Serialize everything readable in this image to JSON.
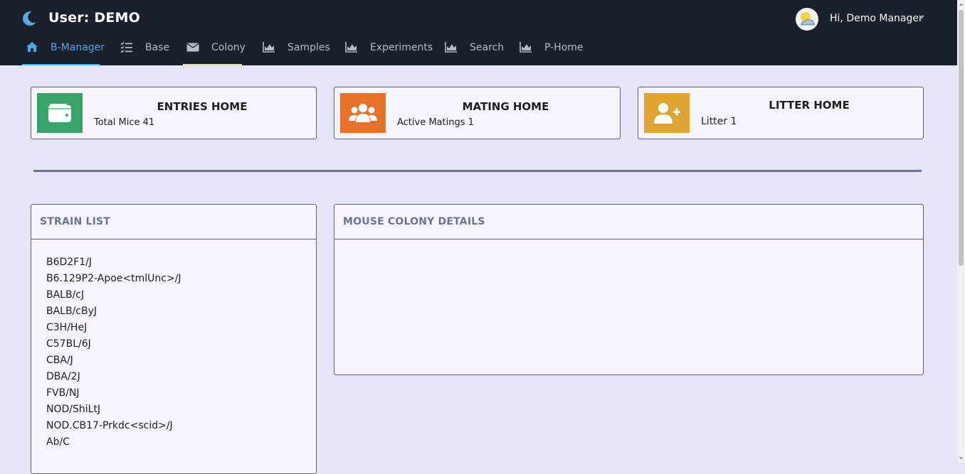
{
  "header": {
    "title": "User: DEMO",
    "greeting": "Hi, Demo Manager",
    "icons": {
      "brand": "moon-icon",
      "avatar": "weather-avatar-icon",
      "menu": "chevron-down-icon"
    }
  },
  "nav": {
    "items": [
      {
        "label": "B-Manager",
        "icon": "home-icon",
        "active": true
      },
      {
        "label": "Base",
        "icon": "checklist-icon",
        "active": false
      },
      {
        "label": "Colony",
        "icon": "envelope-icon",
        "active": false
      },
      {
        "label": "Samples",
        "icon": "area-chart-icon",
        "active": false
      },
      {
        "label": "Experiments",
        "icon": "area-chart-icon",
        "active": false
      },
      {
        "label": "Search",
        "icon": "area-chart-icon",
        "active": false
      },
      {
        "label": "P-Home",
        "icon": "area-chart-icon",
        "active": false
      }
    ]
  },
  "cards": [
    {
      "title": "ENTRIES HOME",
      "subtitle": "Total Mice 41",
      "icon": "wallet-icon",
      "color": "#3aa36a"
    },
    {
      "title": "MATING HOME",
      "subtitle": "Active Matings 1",
      "icon": "users-icon",
      "color": "#e5712a"
    },
    {
      "title": "LITTER HOME",
      "subtitle": "Litter 1",
      "icon": "user-plus-icon",
      "color": "#dea534"
    }
  ],
  "strain_panel": {
    "title": "STRAIN LIST",
    "strains": [
      "B6D2F1/J",
      "B6.129P2-Apoe<tmlUnc>/J",
      "BALB/cJ",
      "BALB/cByJ",
      "C3H/HeJ",
      "C57BL/6J",
      "CBA/J",
      "DBA/2J",
      "FVB/NJ",
      "NOD/ShiLtJ",
      "NOD.CB17-Prkdc<scid>/J",
      "Ab/C"
    ]
  },
  "details_panel": {
    "title": "MOUSE COLONY DETAILS"
  },
  "colors": {
    "header_bg": "#1b202d",
    "page_bg": "#e4e5f7",
    "accent": "#4ea5e8",
    "panel_title": "#6a7391"
  }
}
